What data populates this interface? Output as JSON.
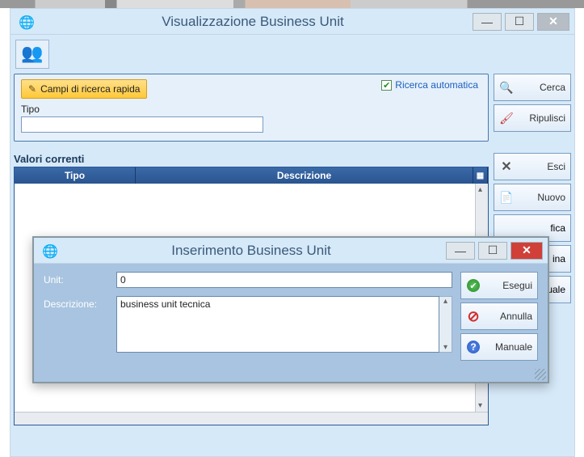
{
  "main": {
    "title": "Visualizzazione Business Unit",
    "quick_search_label": "Campi di ricerca rapida",
    "auto_search_label": "Ricerca automatica",
    "tipo_label": "Tipo",
    "tipo_value": "",
    "side_buttons": {
      "cerca": "Cerca",
      "ripulisci": "Ripulisci",
      "esci": "Esci",
      "nuovo": "Nuovo",
      "modifica": "fica",
      "elimina": "ina",
      "manuale": "uale"
    },
    "grid": {
      "title": "Valori correnti",
      "col_tipo": "Tipo",
      "col_descrizione": "Descrizione"
    }
  },
  "modal": {
    "title": "Inserimento Business Unit",
    "unit_label": "Unit:",
    "unit_value": "0",
    "descr_label": "Descrizione:",
    "descr_value": "business unit tecnica",
    "buttons": {
      "esegui": "Esegui",
      "annulla": "Annulla",
      "manuale": "Manuale"
    }
  }
}
